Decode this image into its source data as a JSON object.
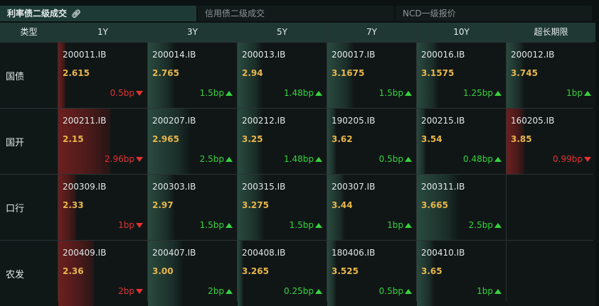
{
  "tabs": [
    {
      "label": "利率债二级成交",
      "active": true
    },
    {
      "label": "信用债二级成交",
      "active": false
    },
    {
      "label": "NCD一级报价",
      "active": false
    }
  ],
  "header": {
    "type_label": "类型",
    "tenors": [
      "1Y",
      "3Y",
      "5Y",
      "7Y",
      "10Y",
      "超长期限"
    ]
  },
  "colors": {
    "up": "#36d23d",
    "down": "#e33232",
    "yield": "#e8b64a",
    "header_bg": "#1f3834"
  },
  "rows": [
    {
      "label": "国债",
      "cells": [
        {
          "code": "200011.IB",
          "yield": "2.615",
          "change": "0.5bp",
          "dir": "down",
          "level": 0.08
        },
        {
          "code": "200014.IB",
          "yield": "2.765",
          "change": "1.5bp",
          "dir": "up",
          "level": 0.3
        },
        {
          "code": "200013.IB",
          "yield": "2.94",
          "change": "1.48bp",
          "dir": "up",
          "level": 0.28
        },
        {
          "code": "200017.IB",
          "yield": "3.1675",
          "change": "1.5bp",
          "dir": "up",
          "level": 0.3
        },
        {
          "code": "200016.IB",
          "yield": "3.1575",
          "change": "1.25bp",
          "dir": "up",
          "level": 0.25
        },
        {
          "code": "200012.IB",
          "yield": "3.745",
          "change": "1bp",
          "dir": "up",
          "level": 0.2
        }
      ]
    },
    {
      "label": "国开",
      "cells": [
        {
          "code": "200211.IB",
          "yield": "2.15",
          "change": "2.96bp",
          "dir": "down",
          "level": 0.58
        },
        {
          "code": "200207.IB",
          "yield": "2.965",
          "change": "2.5bp",
          "dir": "up",
          "level": 0.48
        },
        {
          "code": "200212.IB",
          "yield": "3.25",
          "change": "1.48bp",
          "dir": "up",
          "level": 0.28
        },
        {
          "code": "190205.IB",
          "yield": "3.62",
          "change": "0.5bp",
          "dir": "up",
          "level": 0.1
        },
        {
          "code": "200215.IB",
          "yield": "3.54",
          "change": "0.48bp",
          "dir": "up",
          "level": 0.1
        },
        {
          "code": "160205.IB",
          "yield": "3.85",
          "change": "0.99bp",
          "dir": "down",
          "level": 0.2
        }
      ]
    },
    {
      "label": "口行",
      "cells": [
        {
          "code": "200309.IB",
          "yield": "2.33",
          "change": "1bp",
          "dir": "down",
          "level": 0.2
        },
        {
          "code": "200303.IB",
          "yield": "2.97",
          "change": "1.5bp",
          "dir": "up",
          "level": 0.3
        },
        {
          "code": "200315.IB",
          "yield": "3.275",
          "change": "1.5bp",
          "dir": "up",
          "level": 0.3
        },
        {
          "code": "200307.IB",
          "yield": "3.44",
          "change": "1bp",
          "dir": "up",
          "level": 0.2
        },
        {
          "code": "200311.IB",
          "yield": "3.665",
          "change": "2.5bp",
          "dir": "up",
          "level": 0.48
        },
        null
      ]
    },
    {
      "label": "农发",
      "cells": [
        {
          "code": "200409.IB",
          "yield": "2.36",
          "change": "2bp",
          "dir": "down",
          "level": 0.4
        },
        {
          "code": "200407.IB",
          "yield": "3.00",
          "change": "2bp",
          "dir": "up",
          "level": 0.4
        },
        {
          "code": "200408.IB",
          "yield": "3.265",
          "change": "0.25bp",
          "dir": "up",
          "level": 0.06
        },
        {
          "code": "180406.IB",
          "yield": "3.525",
          "change": "0.5bp",
          "dir": "up",
          "level": 0.1
        },
        {
          "code": "200410.IB",
          "yield": "3.65",
          "change": "1bp",
          "dir": "up",
          "level": 0.2
        },
        null
      ]
    }
  ]
}
